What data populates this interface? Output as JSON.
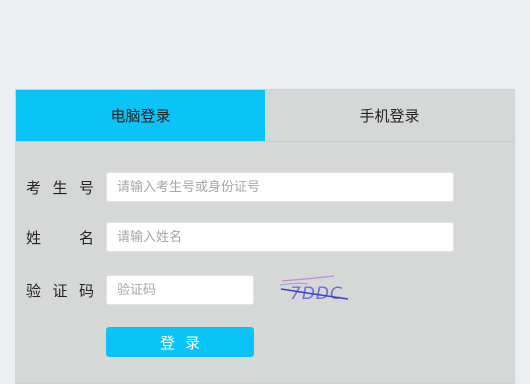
{
  "tabs": [
    {
      "label": "电脑登录",
      "active": true
    },
    {
      "label": "手机登录",
      "active": false
    }
  ],
  "form": {
    "exam_id": {
      "label": "考生号",
      "placeholder": "请输入考生号或身份证号",
      "value": ""
    },
    "name": {
      "label": "姓名",
      "placeholder": "请输入姓名",
      "value": ""
    },
    "captcha": {
      "label": "验证码",
      "placeholder": "验证码",
      "value": "",
      "image_text": "7DDC"
    },
    "submit_label": "登录"
  },
  "colors": {
    "accent": "#0ac4f8",
    "panel_bg": "#d6d8d8",
    "page_bg": "#eceff1"
  }
}
